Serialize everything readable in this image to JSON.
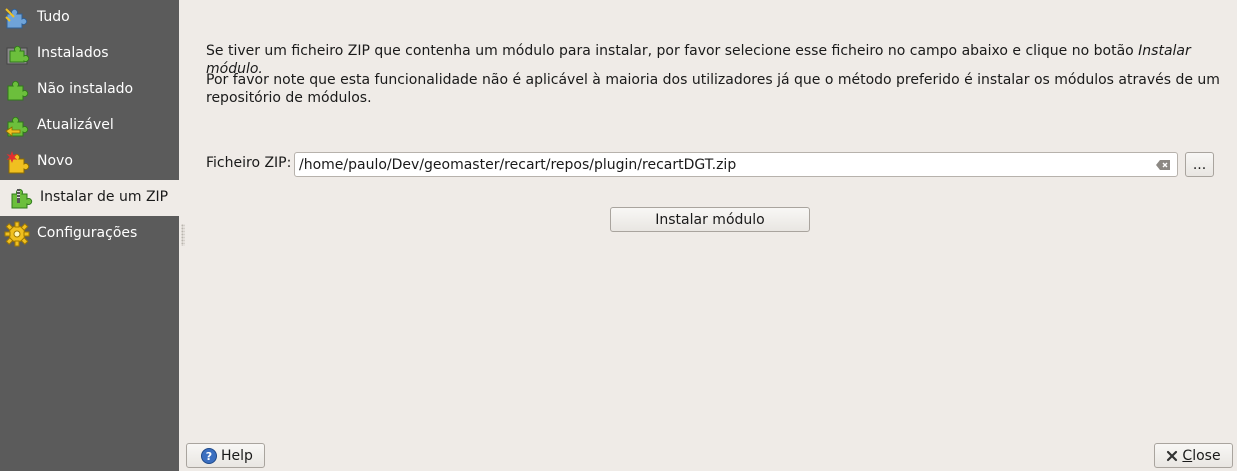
{
  "sidebar": {
    "items": [
      {
        "label": "Tudo",
        "icon": "puzzle-blue-icon"
      },
      {
        "label": "Instalados",
        "icon": "puzzle-green-installed-icon"
      },
      {
        "label": "Não instalado",
        "icon": "puzzle-green-icon"
      },
      {
        "label": "Atualizável",
        "icon": "puzzle-upgrade-icon"
      },
      {
        "label": "Novo",
        "icon": "puzzle-new-icon"
      },
      {
        "label": "Instalar de um ZIP",
        "icon": "puzzle-zip-icon"
      },
      {
        "label": "Configurações",
        "icon": "gear-icon"
      }
    ],
    "active_label": "Instalar de um ZIP"
  },
  "main": {
    "para1_text": "Se tiver um ficheiro ZIP que contenha um módulo para instalar, por favor selecione esse ficheiro no campo abaixo e clique no botão ",
    "para1_italic": "Instalar módulo.",
    "para2_line1": "Por favor note que esta funcionalidade não é aplicável à maioria dos utilizadores já que o método preferido é instalar os módulos através de um",
    "para2_line2": "repositório de módulos.",
    "zip_label": "Ficheiro ZIP:",
    "zip_value": "/home/paulo/Dev/geomaster/recart/repos/plugin/recartDGT.zip",
    "browse_label": "...",
    "install_label": "Instalar módulo"
  },
  "footer": {
    "help_label": "Help",
    "close_label": "Close"
  }
}
